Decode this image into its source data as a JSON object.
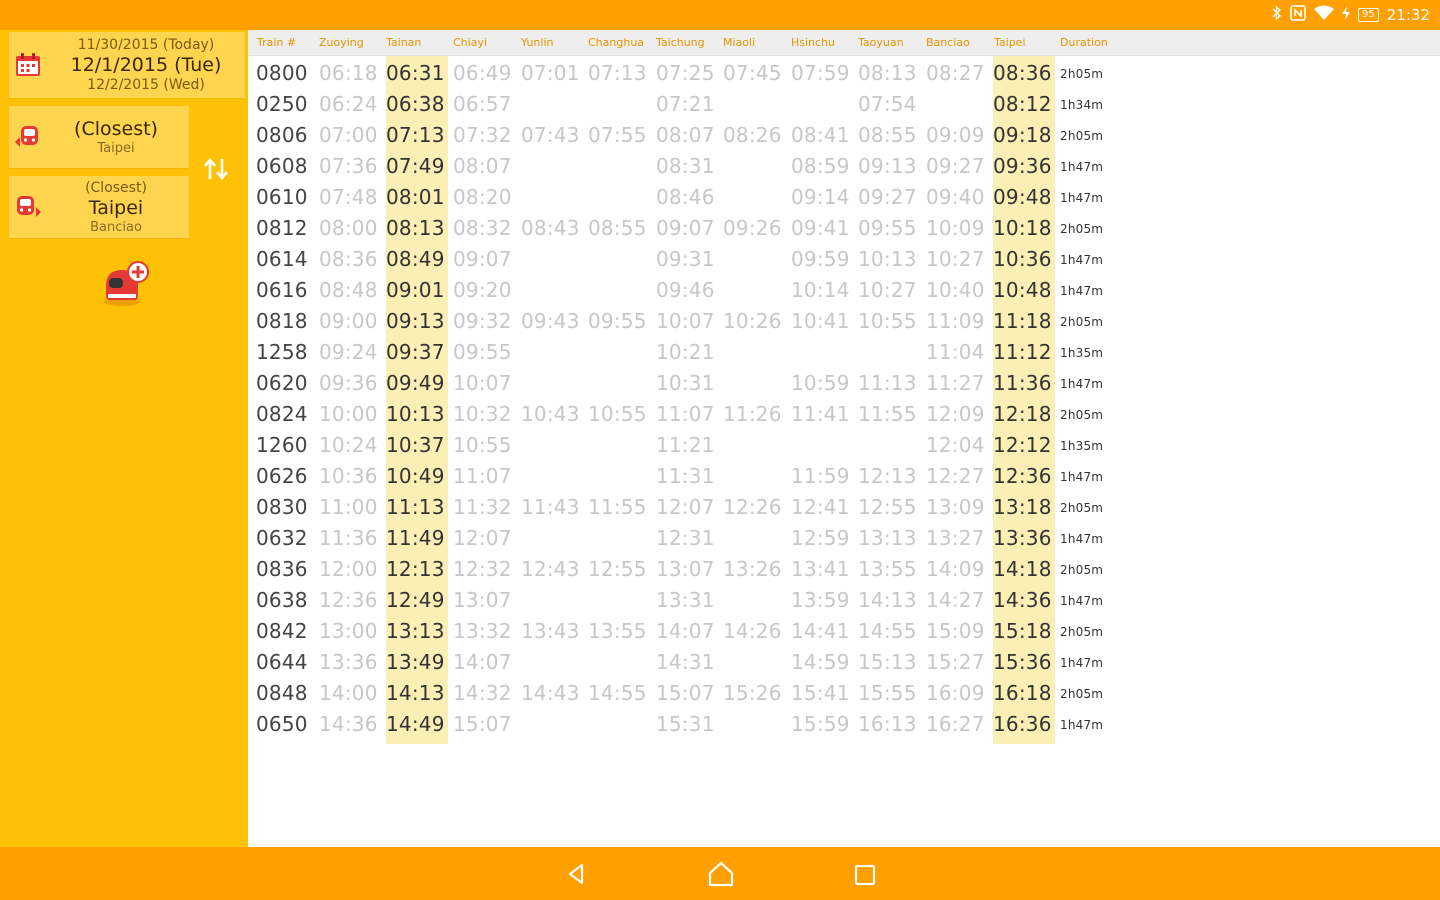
{
  "status_bar": {
    "time": "21:32",
    "battery": "95",
    "icons": [
      "bluetooth-icon",
      "nfc-icon",
      "wifi-icon",
      "charging-icon",
      "battery-icon"
    ]
  },
  "sidebar": {
    "date": {
      "previous": "11/30/2015 (Today)",
      "current": "12/1/2015 (Tue)",
      "next": "12/2/2015 (Wed)"
    },
    "from_station": {
      "main": "(Closest)",
      "sub": "Taipei"
    },
    "to_station": {
      "top": "(Closest)",
      "main": "Taipei",
      "sub": "Banciao"
    }
  },
  "timetable": {
    "headers": [
      "Train #",
      "Zuoying",
      "Tainan",
      "Chiayi",
      "Yunlin",
      "Changhua",
      "Taichung",
      "Miaoli",
      "Hsinchu",
      "Taoyuan",
      "Banciao",
      "Taipei",
      "Duration"
    ],
    "rows": [
      [
        "0800",
        "06:18",
        "06:31",
        "06:49",
        "07:01",
        "07:13",
        "07:25",
        "07:45",
        "07:59",
        "08:13",
        "08:27",
        "08:36",
        "2h05m"
      ],
      [
        "0250",
        "06:24",
        "06:38",
        "06:57",
        "",
        "",
        "07:21",
        "",
        "",
        "07:54",
        "",
        "08:12",
        "1h34m"
      ],
      [
        "0806",
        "07:00",
        "07:13",
        "07:32",
        "07:43",
        "07:55",
        "08:07",
        "08:26",
        "08:41",
        "08:55",
        "09:09",
        "09:18",
        "2h05m"
      ],
      [
        "0608",
        "07:36",
        "07:49",
        "08:07",
        "",
        "",
        "08:31",
        "",
        "08:59",
        "09:13",
        "09:27",
        "09:36",
        "1h47m"
      ],
      [
        "0610",
        "07:48",
        "08:01",
        "08:20",
        "",
        "",
        "08:46",
        "",
        "09:14",
        "09:27",
        "09:40",
        "09:48",
        "1h47m"
      ],
      [
        "0812",
        "08:00",
        "08:13",
        "08:32",
        "08:43",
        "08:55",
        "09:07",
        "09:26",
        "09:41",
        "09:55",
        "10:09",
        "10:18",
        "2h05m"
      ],
      [
        "0614",
        "08:36",
        "08:49",
        "09:07",
        "",
        "",
        "09:31",
        "",
        "09:59",
        "10:13",
        "10:27",
        "10:36",
        "1h47m"
      ],
      [
        "0616",
        "08:48",
        "09:01",
        "09:20",
        "",
        "",
        "09:46",
        "",
        "10:14",
        "10:27",
        "10:40",
        "10:48",
        "1h47m"
      ],
      [
        "0818",
        "09:00",
        "09:13",
        "09:32",
        "09:43",
        "09:55",
        "10:07",
        "10:26",
        "10:41",
        "10:55",
        "11:09",
        "11:18",
        "2h05m"
      ],
      [
        "1258",
        "09:24",
        "09:37",
        "09:55",
        "",
        "",
        "10:21",
        "",
        "",
        "",
        "11:04",
        "11:12",
        "1h35m"
      ],
      [
        "0620",
        "09:36",
        "09:49",
        "10:07",
        "",
        "",
        "10:31",
        "",
        "10:59",
        "11:13",
        "11:27",
        "11:36",
        "1h47m"
      ],
      [
        "0824",
        "10:00",
        "10:13",
        "10:32",
        "10:43",
        "10:55",
        "11:07",
        "11:26",
        "11:41",
        "11:55",
        "12:09",
        "12:18",
        "2h05m"
      ],
      [
        "1260",
        "10:24",
        "10:37",
        "10:55",
        "",
        "",
        "11:21",
        "",
        "",
        "",
        "12:04",
        "12:12",
        "1h35m"
      ],
      [
        "0626",
        "10:36",
        "10:49",
        "11:07",
        "",
        "",
        "11:31",
        "",
        "11:59",
        "12:13",
        "12:27",
        "12:36",
        "1h47m"
      ],
      [
        "0830",
        "11:00",
        "11:13",
        "11:32",
        "11:43",
        "11:55",
        "12:07",
        "12:26",
        "12:41",
        "12:55",
        "13:09",
        "13:18",
        "2h05m"
      ],
      [
        "0632",
        "11:36",
        "11:49",
        "12:07",
        "",
        "",
        "12:31",
        "",
        "12:59",
        "13:13",
        "13:27",
        "13:36",
        "1h47m"
      ],
      [
        "0836",
        "12:00",
        "12:13",
        "12:32",
        "12:43",
        "12:55",
        "13:07",
        "13:26",
        "13:41",
        "13:55",
        "14:09",
        "14:18",
        "2h05m"
      ],
      [
        "0638",
        "12:36",
        "12:49",
        "13:07",
        "",
        "",
        "13:31",
        "",
        "13:59",
        "14:13",
        "14:27",
        "14:36",
        "1h47m"
      ],
      [
        "0842",
        "13:00",
        "13:13",
        "13:32",
        "13:43",
        "13:55",
        "14:07",
        "14:26",
        "14:41",
        "14:55",
        "15:09",
        "15:18",
        "2h05m"
      ],
      [
        "0644",
        "13:36",
        "13:49",
        "14:07",
        "",
        "",
        "14:31",
        "",
        "14:59",
        "15:13",
        "15:27",
        "15:36",
        "1h47m"
      ],
      [
        "0848",
        "14:00",
        "14:13",
        "14:32",
        "14:43",
        "14:55",
        "15:07",
        "15:26",
        "15:41",
        "15:55",
        "16:09",
        "16:18",
        "2h05m"
      ],
      [
        "0650",
        "14:36",
        "14:49",
        "15:07",
        "",
        "",
        "15:31",
        "",
        "15:59",
        "16:13",
        "16:27",
        "16:36",
        "1h47m"
      ]
    ]
  },
  "colors": {
    "status_bar": "#ff9f00",
    "sidebar": "#ffc107",
    "panel": "#ffd54f",
    "highlight_column": "#fbefb6",
    "header_text": "#e69400",
    "nav_bar": "#ff9f00"
  },
  "nav_bar": {
    "icons": [
      "back-icon",
      "home-icon",
      "recents-icon"
    ]
  }
}
